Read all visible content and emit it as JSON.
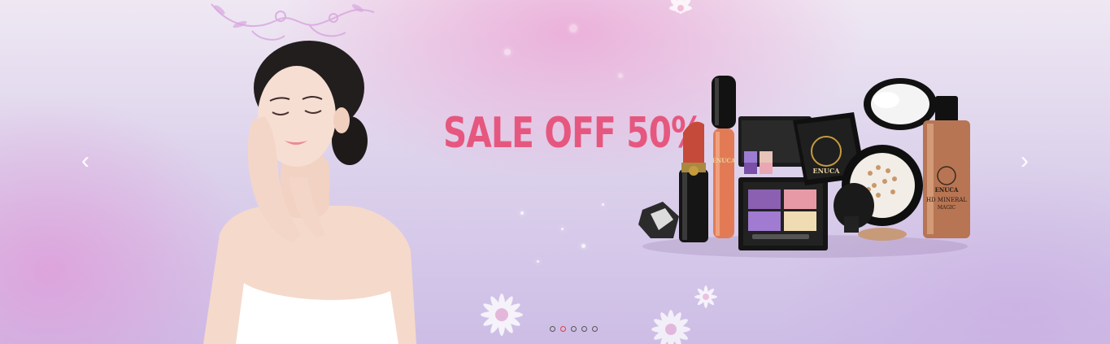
{
  "slider": {
    "headline": "SALE OFF 50%",
    "prev_label": "‹",
    "next_label": "›",
    "dots": [
      {
        "active": false
      },
      {
        "active": true
      },
      {
        "active": false
      },
      {
        "active": false
      },
      {
        "active": false
      }
    ]
  },
  "products": {
    "brand": "ENUCA",
    "foundation_line1": "HD MINERAL",
    "foundation_line2": "MAGIC"
  },
  "colors": {
    "headline": "#e6577f",
    "active_dot": "#e04040",
    "inactive_dot": "#555555"
  }
}
